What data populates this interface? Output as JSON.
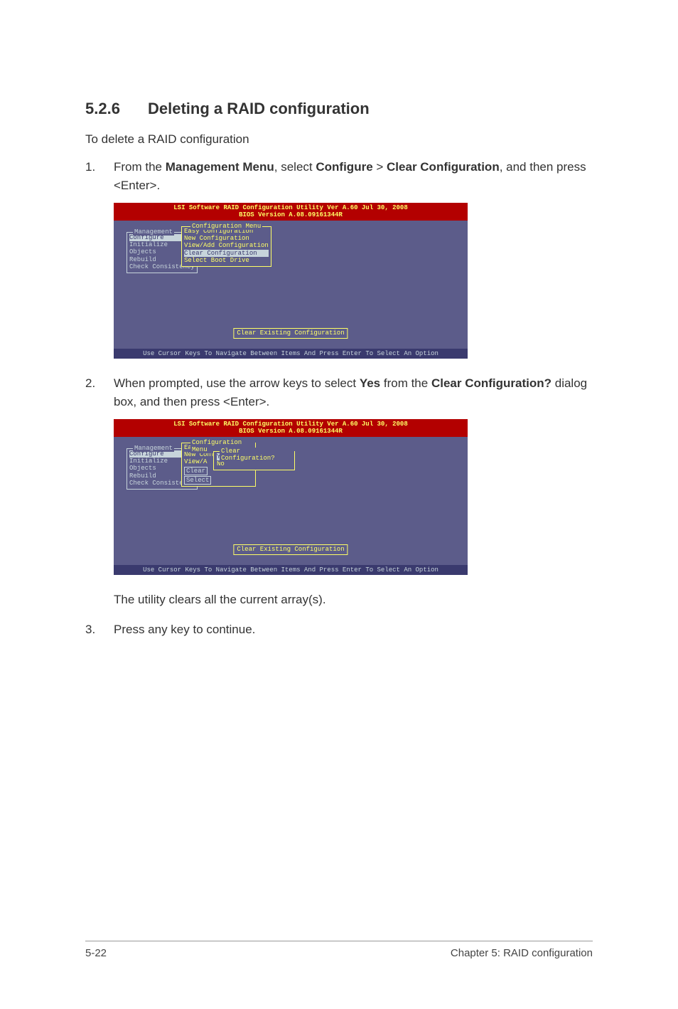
{
  "heading": {
    "num": "5.2.6",
    "title": "Deleting a RAID configuration"
  },
  "intro": "To delete a RAID configuration",
  "step1": {
    "num": "1.",
    "pre": "From the ",
    "b1": "Management Menu",
    "mid1": ", select ",
    "b2": "Configure",
    "mid2": " > ",
    "b3": "Clear Configuration",
    "post": ", and then press <Enter>."
  },
  "bios1": {
    "header1": "LSI Software RAID Configuration Utility Ver A.60 Jul 30, 2008",
    "header2": "BIOS Version  A.08.09161344R",
    "mgmt": {
      "title": "Management",
      "items": [
        "Configure",
        "Initialize",
        "Objects",
        "Rebuild",
        "Check Consistency"
      ],
      "selected": 0
    },
    "cfg": {
      "title": "Configuration Menu",
      "items": [
        "Easy Configuration",
        "New Configuration",
        "View/Add Configuration",
        "Clear Configuration",
        "Select Boot Drive"
      ],
      "selected": 3
    },
    "status": "Clear Existing Configuration",
    "footer": "Use Cursor Keys To Navigate Between Items And Press Enter To Select An Option"
  },
  "step2": {
    "num": "2.",
    "pre": "When prompted, use the arrow keys to select ",
    "b1": "Yes",
    "mid1": " from the ",
    "b2": "Clear Configuration?",
    "post": " dialog box, and then press <Enter>."
  },
  "bios2": {
    "header1": "LSI Software RAID Configuration Utility Ver A.60 Jul 30, 2008",
    "header2": "BIOS Version  A.08.09161344R",
    "mgmt": {
      "title": "Management",
      "items": [
        "Configure",
        "Initialize",
        "Objects",
        "Rebuild",
        "Check Consistency"
      ],
      "selected": 0
    },
    "cfg": {
      "title": "Configuration Menu",
      "easy": "Easy Configuration",
      "new": "New Configuration",
      "view_trunc": "View/A",
      "clear_trunc": "Clear",
      "select_trunc": "Select"
    },
    "dialog": {
      "title": "Clear Configuration?",
      "yes": "Yes",
      "no": "No"
    },
    "status": "Clear Existing Configuration",
    "footer": "Use Cursor Keys To Navigate Between Items And Press Enter To Select An Option"
  },
  "post2": "The utility clears all the current array(s).",
  "step3": {
    "num": "3.",
    "text": "Press any key to continue."
  },
  "footer": {
    "left": "5-22",
    "right": "Chapter 5: RAID configuration"
  }
}
